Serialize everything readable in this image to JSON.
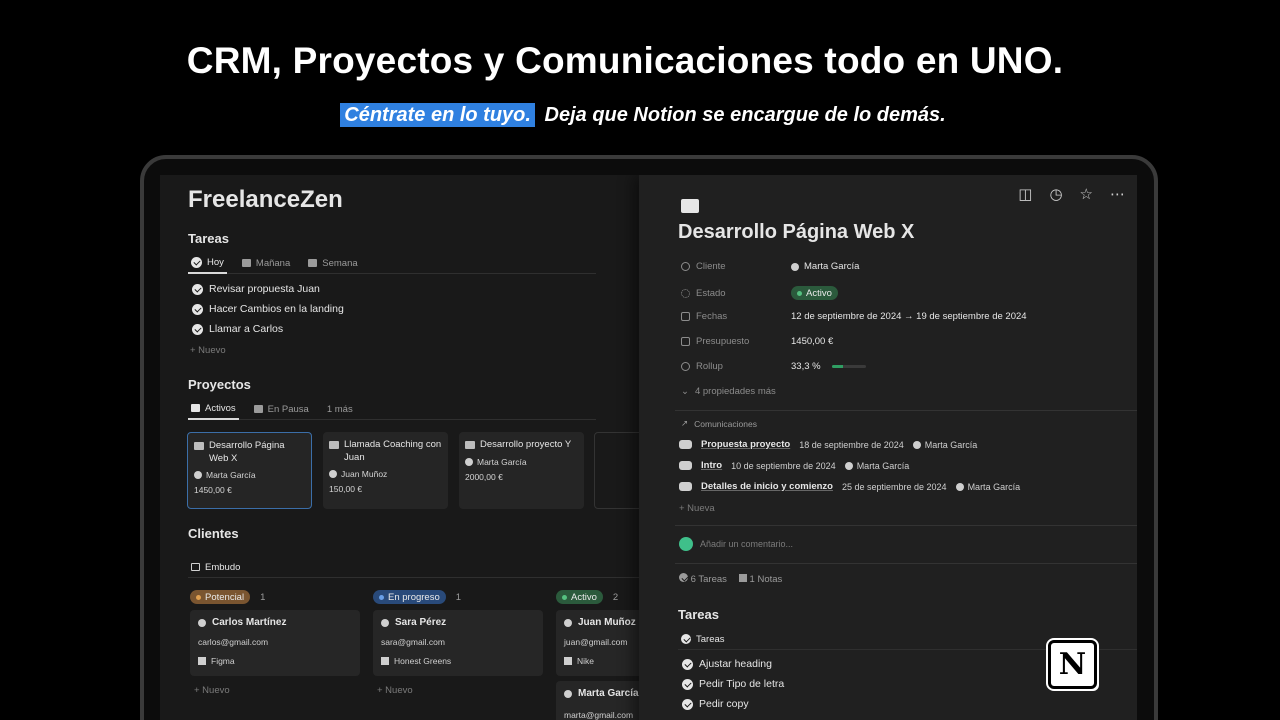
{
  "hero": {
    "title": "CRM, Proyectos y Comunicaciones todo en UNO.",
    "highlight": "Céntrate en lo tuyo.",
    "subtitle": "Deja que Notion se encargue de lo demás."
  },
  "workspace": {
    "title": "FreelanceZen"
  },
  "tareas": {
    "title": "Tareas",
    "tabs": [
      "Hoy",
      "Mañana",
      "Semana"
    ],
    "items": [
      "Revisar propuesta Juan",
      "Hacer Cambios en la landing",
      "Llamar a Carlos"
    ],
    "new_label": "+ Nuevo"
  },
  "proyectos": {
    "title": "Proyectos",
    "tabs": [
      "Activos",
      "En Pausa"
    ],
    "more": "1 más",
    "cards": [
      {
        "title": "Desarrollo Página Web X",
        "person": "Marta García",
        "amount": "1450,00 €"
      },
      {
        "title": "Llamada Coaching con Juan",
        "person": "Juan Muñoz",
        "amount": "150,00 €"
      },
      {
        "title": "Desarrollo proyecto Y",
        "person": "Marta García",
        "amount": "2000,00 €"
      }
    ]
  },
  "clientes": {
    "title": "Clientes",
    "view": "Embudo",
    "columns": [
      {
        "status": "Potencial",
        "count": "1",
        "color": "#7a5530",
        "dot": "#e0a050"
      },
      {
        "status": "En progreso",
        "count": "1",
        "color": "#294a7a",
        "dot": "#6aa0e8"
      },
      {
        "status": "Activo",
        "count": "2",
        "color": "#2b5a3c",
        "dot": "#55c080"
      }
    ],
    "cards": [
      {
        "name": "Carlos Martínez",
        "email": "carlos@gmail.com",
        "company": "Figma"
      },
      {
        "name": "Sara Pérez",
        "email": "sara@gmail.com",
        "company": "Honest Greens"
      },
      {
        "name": "Juan Muñoz",
        "email": "juan@gmail.com",
        "company": "Nike"
      },
      {
        "name": "Marta García",
        "email": "marta@gmail.com",
        "company": ""
      }
    ],
    "new_label": "+ Nuevo"
  },
  "detail": {
    "title": "Desarrollo Página Web X",
    "icons": [
      "comment-icon",
      "clock-icon",
      "star-icon",
      "more-icon"
    ],
    "props": {
      "cliente_label": "Cliente",
      "cliente": "Marta García",
      "estado_label": "Estado",
      "estado": "Activo",
      "fechas_label": "Fechas",
      "fechas": "12 de septiembre de 2024 → 19 de septiembre de 2024",
      "presupuesto_label": "Presupuesto",
      "presupuesto": "1450,00 €",
      "rollup_label": "Rollup",
      "rollup": "33,3 %",
      "rollup_fraction": 0.333,
      "more": "4 propiedades más"
    },
    "comunicaciones": {
      "title": "Comunicaciones",
      "items": [
        {
          "title": "Propuesta proyecto",
          "date": "18 de septiembre de 2024",
          "person": "Marta García"
        },
        {
          "title": "Intro",
          "date": "10 de septiembre de 2024",
          "person": "Marta García"
        },
        {
          "title": "Detalles de inicio y comienzo",
          "date": "25 de septiembre de 2024",
          "person": "Marta García"
        }
      ],
      "new_label": "+ Nueva"
    },
    "comment_placeholder": "Añadir un comentario...",
    "counts": {
      "tareas": "6 Tareas",
      "notas": "1 Notas"
    },
    "tareas": {
      "title": "Tareas",
      "tab": "Tareas",
      "items": [
        "Ajustar heading",
        "Pedir Tipo de letra",
        "Pedir copy"
      ]
    }
  },
  "logo": "N"
}
